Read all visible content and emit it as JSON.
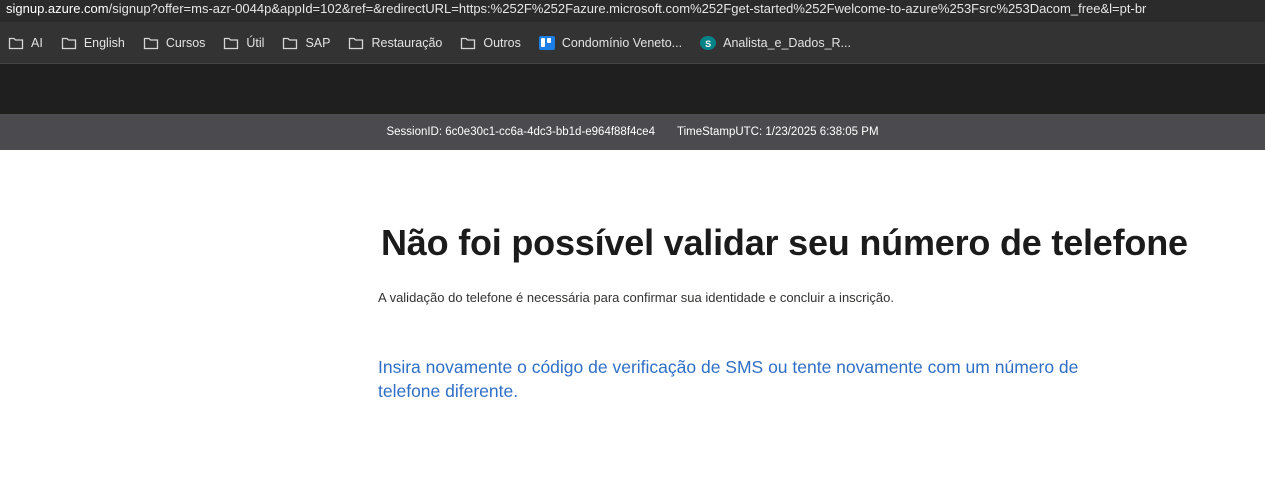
{
  "browser": {
    "url_domain": "signup.azure.com",
    "url_rest": "/signup?offer=ms-azr-0044p&appId=102&ref=&redirectURL=https:%252F%252Fazure.microsoft.com%252Fget-started%252Fwelcome-to-azure%253Fsrc%253Dacom_free&l=pt-br"
  },
  "bookmarks": [
    {
      "label": "AI",
      "icon": "folder-icon"
    },
    {
      "label": "English",
      "icon": "folder-icon"
    },
    {
      "label": "Cursos",
      "icon": "folder-icon"
    },
    {
      "label": "Útil",
      "icon": "folder-icon"
    },
    {
      "label": "SAP",
      "icon": "folder-icon"
    },
    {
      "label": "Restauração",
      "icon": "folder-icon"
    },
    {
      "label": "Outros",
      "icon": "folder-icon"
    },
    {
      "label": "Condomínio Veneto...",
      "icon": "trello-icon"
    },
    {
      "label": "Analista_e_Dados_R...",
      "icon": "sharepoint-icon",
      "icon_letter": "S"
    }
  ],
  "session": {
    "session_id": "SessionID: 6c0e30c1-cc6a-4dc3-bb1d-e964f88f4ce4",
    "timestamp": "TimeStampUTC: 1/23/2025 6:38:05 PM"
  },
  "main": {
    "heading": "Não foi possível validar seu número de telefone",
    "description": "A validação do telefone é necessária para confirmar sua identidade e concluir a inscrição.",
    "retry_link": "Insira novamente o código de verificação de SMS ou tente novamente com um número de telefone diferente."
  },
  "colors": {
    "link": "#2f6fc6",
    "session_bar": "#4a4a4f",
    "header_dark": "#1f1f1f"
  }
}
